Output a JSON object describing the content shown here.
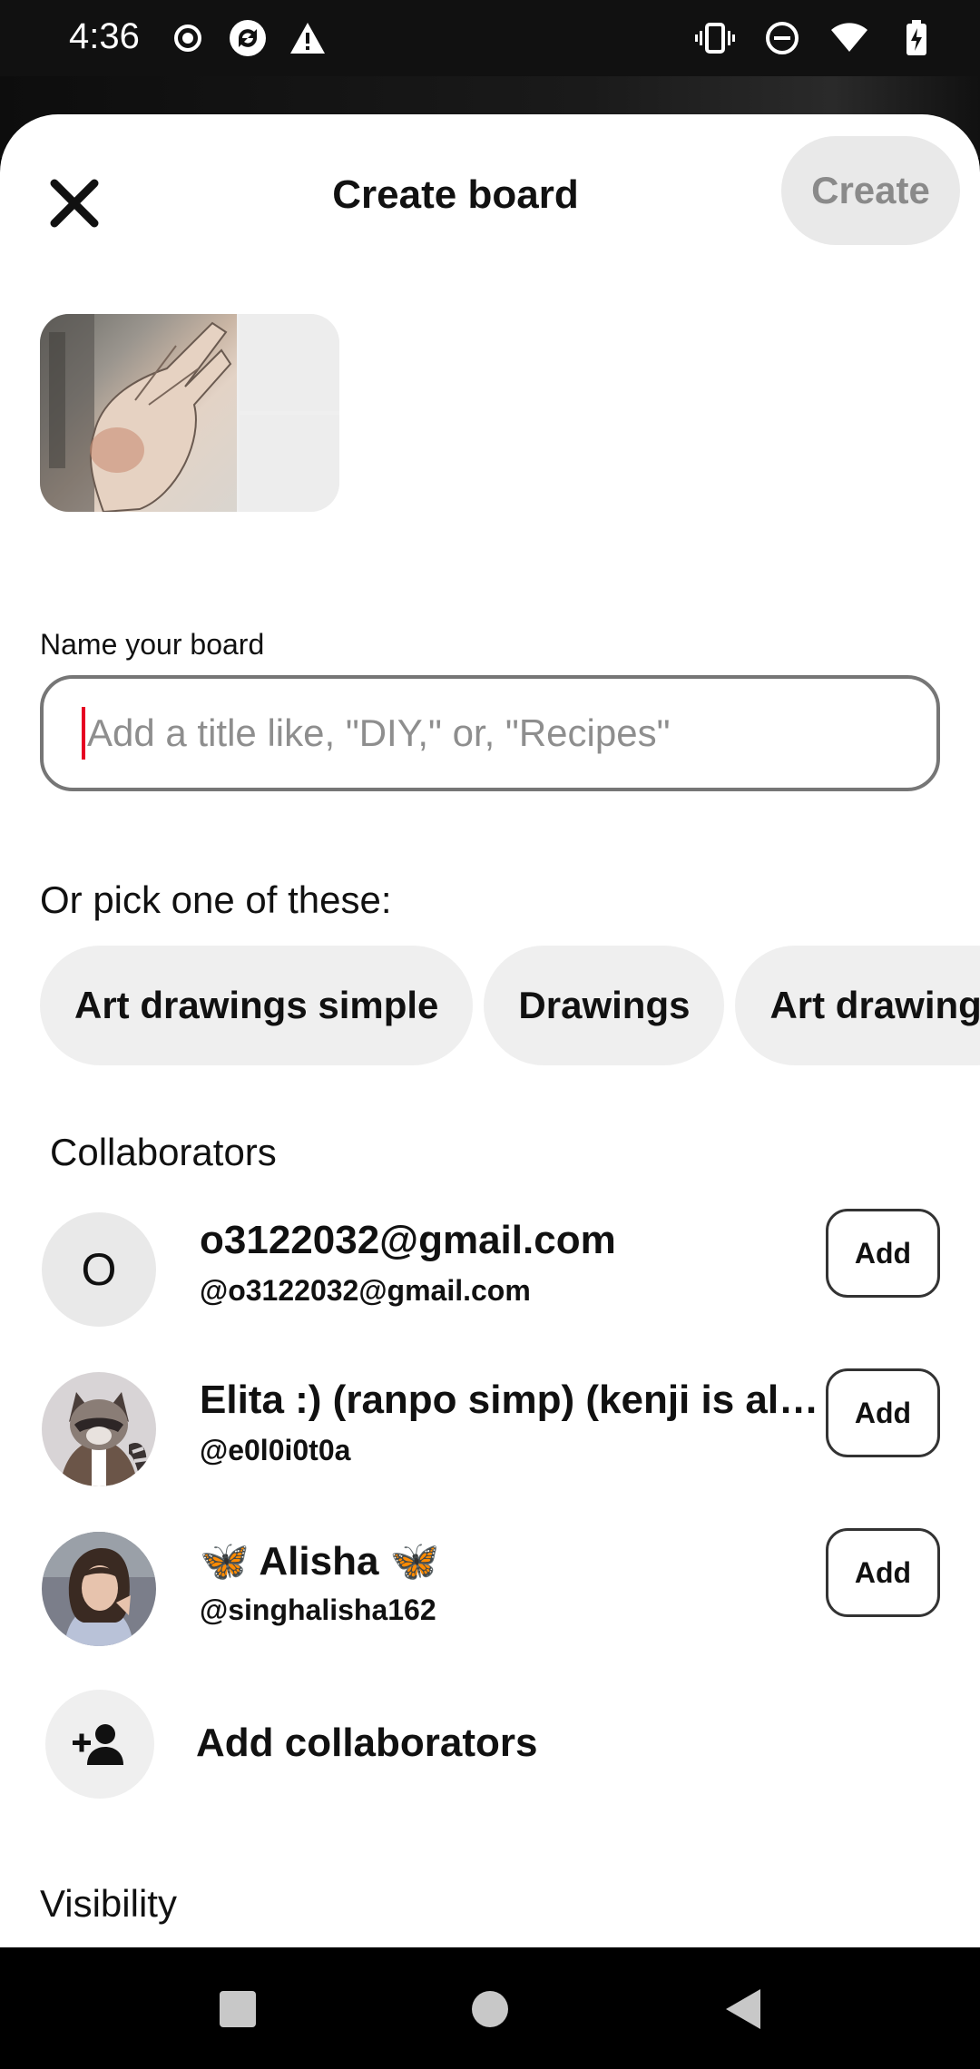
{
  "status_bar": {
    "time": "4:36",
    "left_icons": [
      "record-icon",
      "sync-icon",
      "warning-icon"
    ],
    "right_icons": [
      "vibrate-icon",
      "do-not-disturb-icon",
      "wifi-icon",
      "battery-charging-icon"
    ]
  },
  "header": {
    "title": "Create board",
    "create_label": "Create"
  },
  "form": {
    "name_label": "Name your board",
    "name_placeholder": "Add a title like, \"DIY,\" or, \"Recipes\"",
    "name_value": "",
    "pick_label": "Or pick one of these:"
  },
  "suggestions": [
    "Art drawings simple",
    "Drawings",
    "Art drawings"
  ],
  "collaborators": {
    "label": "Collaborators",
    "items": [
      {
        "name": "o3122032@gmail.com",
        "handle": "@o3122032@gmail.com",
        "avatar_letter": "O",
        "add_label": "Add"
      },
      {
        "name": "Elita :) (ranpo simp) (kenji is alive…",
        "handle": "@e0l0i0t0a",
        "add_label": "Add"
      },
      {
        "name": "🦋 Alisha 🦋",
        "handle": "@singhalisha162",
        "add_label": "Add"
      }
    ],
    "add_collaborators_label": "Add collaborators"
  },
  "visibility_label": "Visibility",
  "colors": {
    "accent_caret": "#e60023",
    "chip_bg": "#efefef",
    "create_bg": "#e9e9e9"
  }
}
